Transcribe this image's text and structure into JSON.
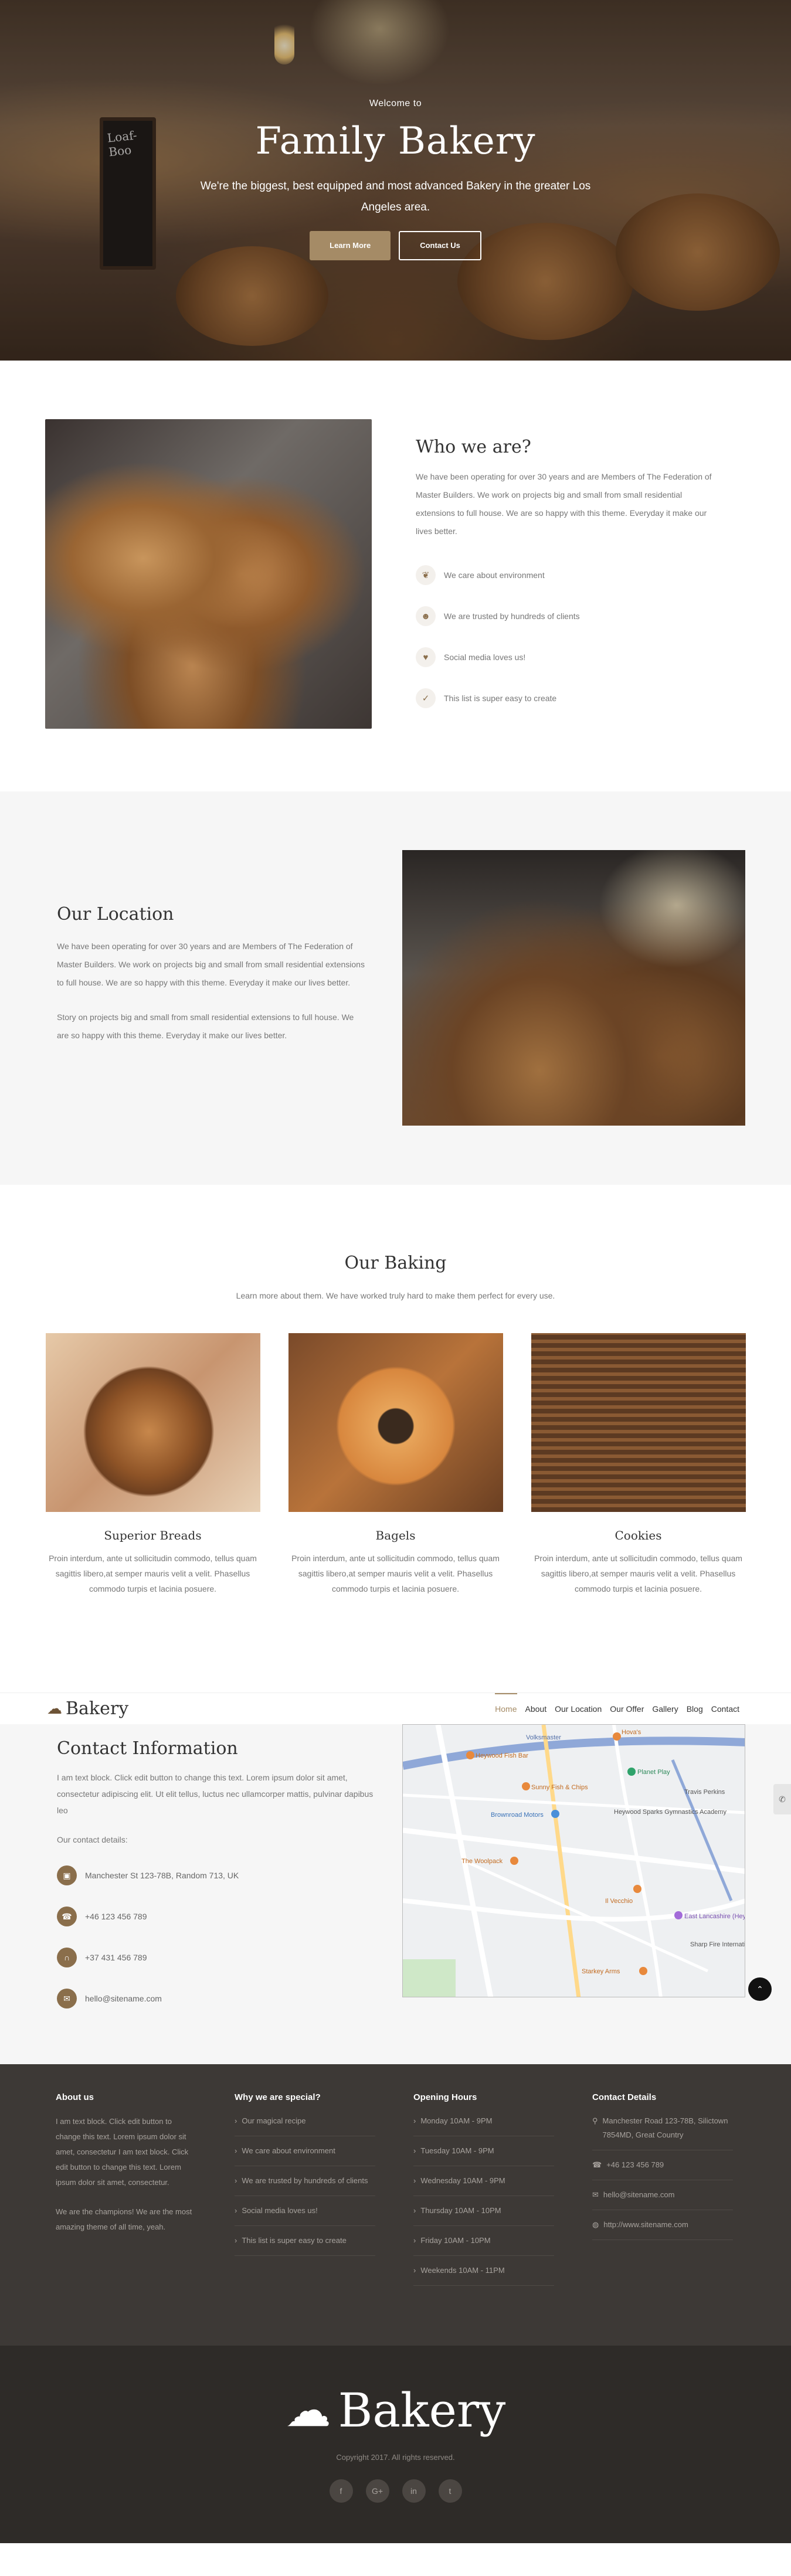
{
  "hero": {
    "kicker": "Welcome to",
    "title": "Family Bakery",
    "lead": "We're the biggest, best equipped and most advanced Bakery in the greater Los Angeles area.",
    "primary_button": "Learn More",
    "secondary_button": "Contact Us",
    "chalkboard_text": "Loaf-Boo"
  },
  "who": {
    "title": "Who we are?",
    "text": "We have been operating for over 30 years and are Members of The Federation of Master Builders. We work on projects big and small from small residential extensions to full house. We are so happy with this theme. Everyday it make our lives better.",
    "features": [
      {
        "icon": "leaf-icon",
        "label": "We care about environment"
      },
      {
        "icon": "users-icon",
        "label": "We are trusted by hundreds of clients"
      },
      {
        "icon": "heart-icon",
        "label": "Social media loves us!"
      },
      {
        "icon": "check-icon",
        "label": "This list is super easy to create"
      }
    ]
  },
  "location": {
    "title": "Our Location",
    "text1": "We have been operating for over 30 years and are Members of The Federation of Master Builders. We work on projects big and small from small residential extensions to full house. We are so happy with this theme. Everyday it make our lives better.",
    "text2": "Story on projects big and small from small residential extensions to full house. We are so happy with this theme. Everyday it make our lives better."
  },
  "baking": {
    "title": "Our Baking",
    "subtitle": "Learn more about them. We have worked truly hard to make them perfect for every use.",
    "items": [
      {
        "title": "Superior Breads",
        "text": "Proin interdum, ante ut sollicitudin commodo, tellus quam sagittis libero,at semper mauris velit a velit. Phasellus commodo turpis et lacinia posuere."
      },
      {
        "title": "Bagels",
        "text": "Proin interdum, ante ut sollicitudin commodo, tellus quam sagittis libero,at semper mauris velit a velit. Phasellus commodo turpis et lacinia posuere."
      },
      {
        "title": "Cookies",
        "text": "Proin interdum, ante ut sollicitudin commodo, tellus quam sagittis libero,at semper mauris velit a velit. Phasellus commodo turpis et lacinia posuere."
      }
    ]
  },
  "nav": {
    "logo": "Bakery",
    "items": [
      "Home",
      "About",
      "Our Location",
      "Our Offer",
      "Gallery",
      "Blog",
      "Contact"
    ]
  },
  "contact": {
    "title": "Contact Information",
    "text": "I am text block. Click edit button to change this text. Lorem ipsum dolor sit amet, consectetur adipiscing elit. Ut elit tellus, luctus nec ullamcorper mattis, pulvinar dapibus leo",
    "details_label": "Our contact details:",
    "items": [
      {
        "icon": "map-icon",
        "label": "Manchester St 123-78B, Random 713, UK"
      },
      {
        "icon": "phone-icon",
        "label": "+46 123 456 789"
      },
      {
        "icon": "headset-icon",
        "label": "+37 431 456 789"
      },
      {
        "icon": "mail-icon",
        "label": "hello@sitename.com"
      }
    ],
    "map_labels": {
      "a": "Volksmaster",
      "b": "Hova's",
      "c": "Heywood Fish Bar",
      "d": "Planet Play",
      "e": "Sunny Fish & Chips",
      "f": "Brownroad Motors",
      "g": "Heywood Sparks Gymnastics Academy",
      "h": "Travis Perkins",
      "i": "The Woolpack",
      "j": "Il Vecchio",
      "k": "East Lancashire (Heywood Station)",
      "l": "Sharp Fire Internationa",
      "m": "Starkey Arms"
    }
  },
  "footer": {
    "about": {
      "title": "About us",
      "text1": "I am text block. Click edit button to change this text. Lorem ipsum dolor sit amet, consectetur I am text block. Click edit button to change this text. Lorem ipsum dolor sit amet, consectetur.",
      "text2": "We are the champions! We are the most amazing theme of all time, yeah."
    },
    "special": {
      "title": "Why we are special?",
      "items": [
        "Our magical recipe",
        "We care about environment",
        "We are trusted by hundreds of clients",
        "Social media loves us!",
        "This list is super easy to create"
      ]
    },
    "hours": {
      "title": "Opening Hours",
      "items": [
        "Monday 10AM - 9PM",
        "Tuesday 10AM - 9PM",
        "Wednesday 10AM - 9PM",
        "Thursday 10AM - 10PM",
        "Friday 10AM - 10PM",
        "Weekends 10AM - 11PM"
      ]
    },
    "contact": {
      "title": "Contact Details",
      "items": [
        {
          "icon": "map-icon",
          "label": "Manchester Road 123-78B, Silictown 7854MD, Great Country"
        },
        {
          "icon": "phone-icon",
          "label": "+46 123 456 789"
        },
        {
          "icon": "mail-icon",
          "label": "hello@sitename.com"
        },
        {
          "icon": "globe-icon",
          "label": "http://www.sitename.com"
        }
      ]
    }
  },
  "bottom": {
    "logo": "Bakery",
    "copyright": "Copyright 2017. All rights reserved.",
    "social": [
      "f",
      "G+",
      "in",
      "t"
    ]
  }
}
